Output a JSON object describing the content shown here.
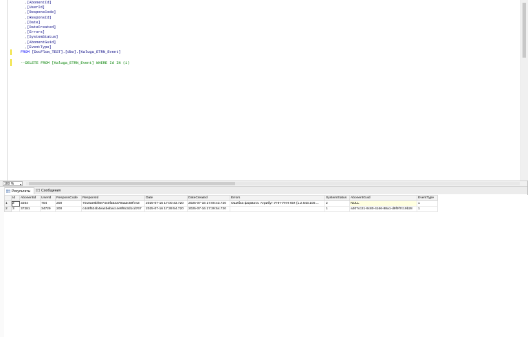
{
  "editor": {
    "lines": [
      {
        "indent": "        ",
        "prefix": ",",
        "text": "[AbonentId]"
      },
      {
        "indent": "        ",
        "prefix": ",",
        "text": "[UserId]"
      },
      {
        "indent": "        ",
        "prefix": ",",
        "text": "[ResponsCode]"
      },
      {
        "indent": "        ",
        "prefix": ",",
        "text": "[ResponsId]"
      },
      {
        "indent": "        ",
        "prefix": ",",
        "text": "[Date]"
      },
      {
        "indent": "        ",
        "prefix": ",",
        "text": "[DateCreated]"
      },
      {
        "indent": "        ",
        "prefix": ",",
        "text": "[Errors]"
      },
      {
        "indent": "        ",
        "prefix": ",",
        "text": "[SystemStatus]"
      },
      {
        "indent": "        ",
        "prefix": ",",
        "text": "[AbonentGuid]"
      },
      {
        "indent": "        ",
        "prefix": ",",
        "text": "[EventType]"
      }
    ],
    "from_keyword": "FROM",
    "from_target": "[DocFlow_TEST].[dbo].[Kaluga_ETRN_Event]",
    "comment_line": "--DELETE FROM [Kaluga_ETRN_Event] WHERE Id IN (1)"
  },
  "zoom": {
    "value": "100 %"
  },
  "tabs": {
    "results": "Результаты",
    "messages": "Сообщения"
  },
  "grid": {
    "columns": [
      "Id",
      "AbonentId",
      "UserId",
      "ResponsCode",
      "ResponsId",
      "Date",
      "DateCreated",
      "Errors",
      "SystemStatus",
      "AbonentGuid",
      "EventType"
    ],
    "rows": [
      {
        "num": "1",
        "cells": [
          "2",
          "3264",
          "704",
          "200",
          "7010ae8bf8e7440fa53379aa3c59f7a3",
          "2025-07-16 17:00:43.720",
          "2025-07-16 17:00:43.720",
          "Ошибка формата. Атрибут УНН-УНН ЮЛ (1.2.643.100....",
          "2",
          "NULL",
          "1"
        ]
      },
      {
        "num": "2",
        "cells": [
          "3",
          "37281",
          "34729",
          "200",
          "c448f524b4ea4bebacc4e9f8c3d1cd767",
          "2025-07-16 17:39:54.720",
          "2025-07-16 17:39:54.720",
          "",
          "1",
          "a307cc21-9c80-4166-88a1-d9f9f7c19b28",
          "1"
        ]
      }
    ]
  },
  "colors": {
    "keyword": "#0000ff",
    "comment": "#008000",
    "null_bg": "#ffffe1",
    "change_bar": "#f0e030"
  },
  "icons": {
    "results_tab": "grid-icon",
    "messages_tab": "message-icon"
  }
}
